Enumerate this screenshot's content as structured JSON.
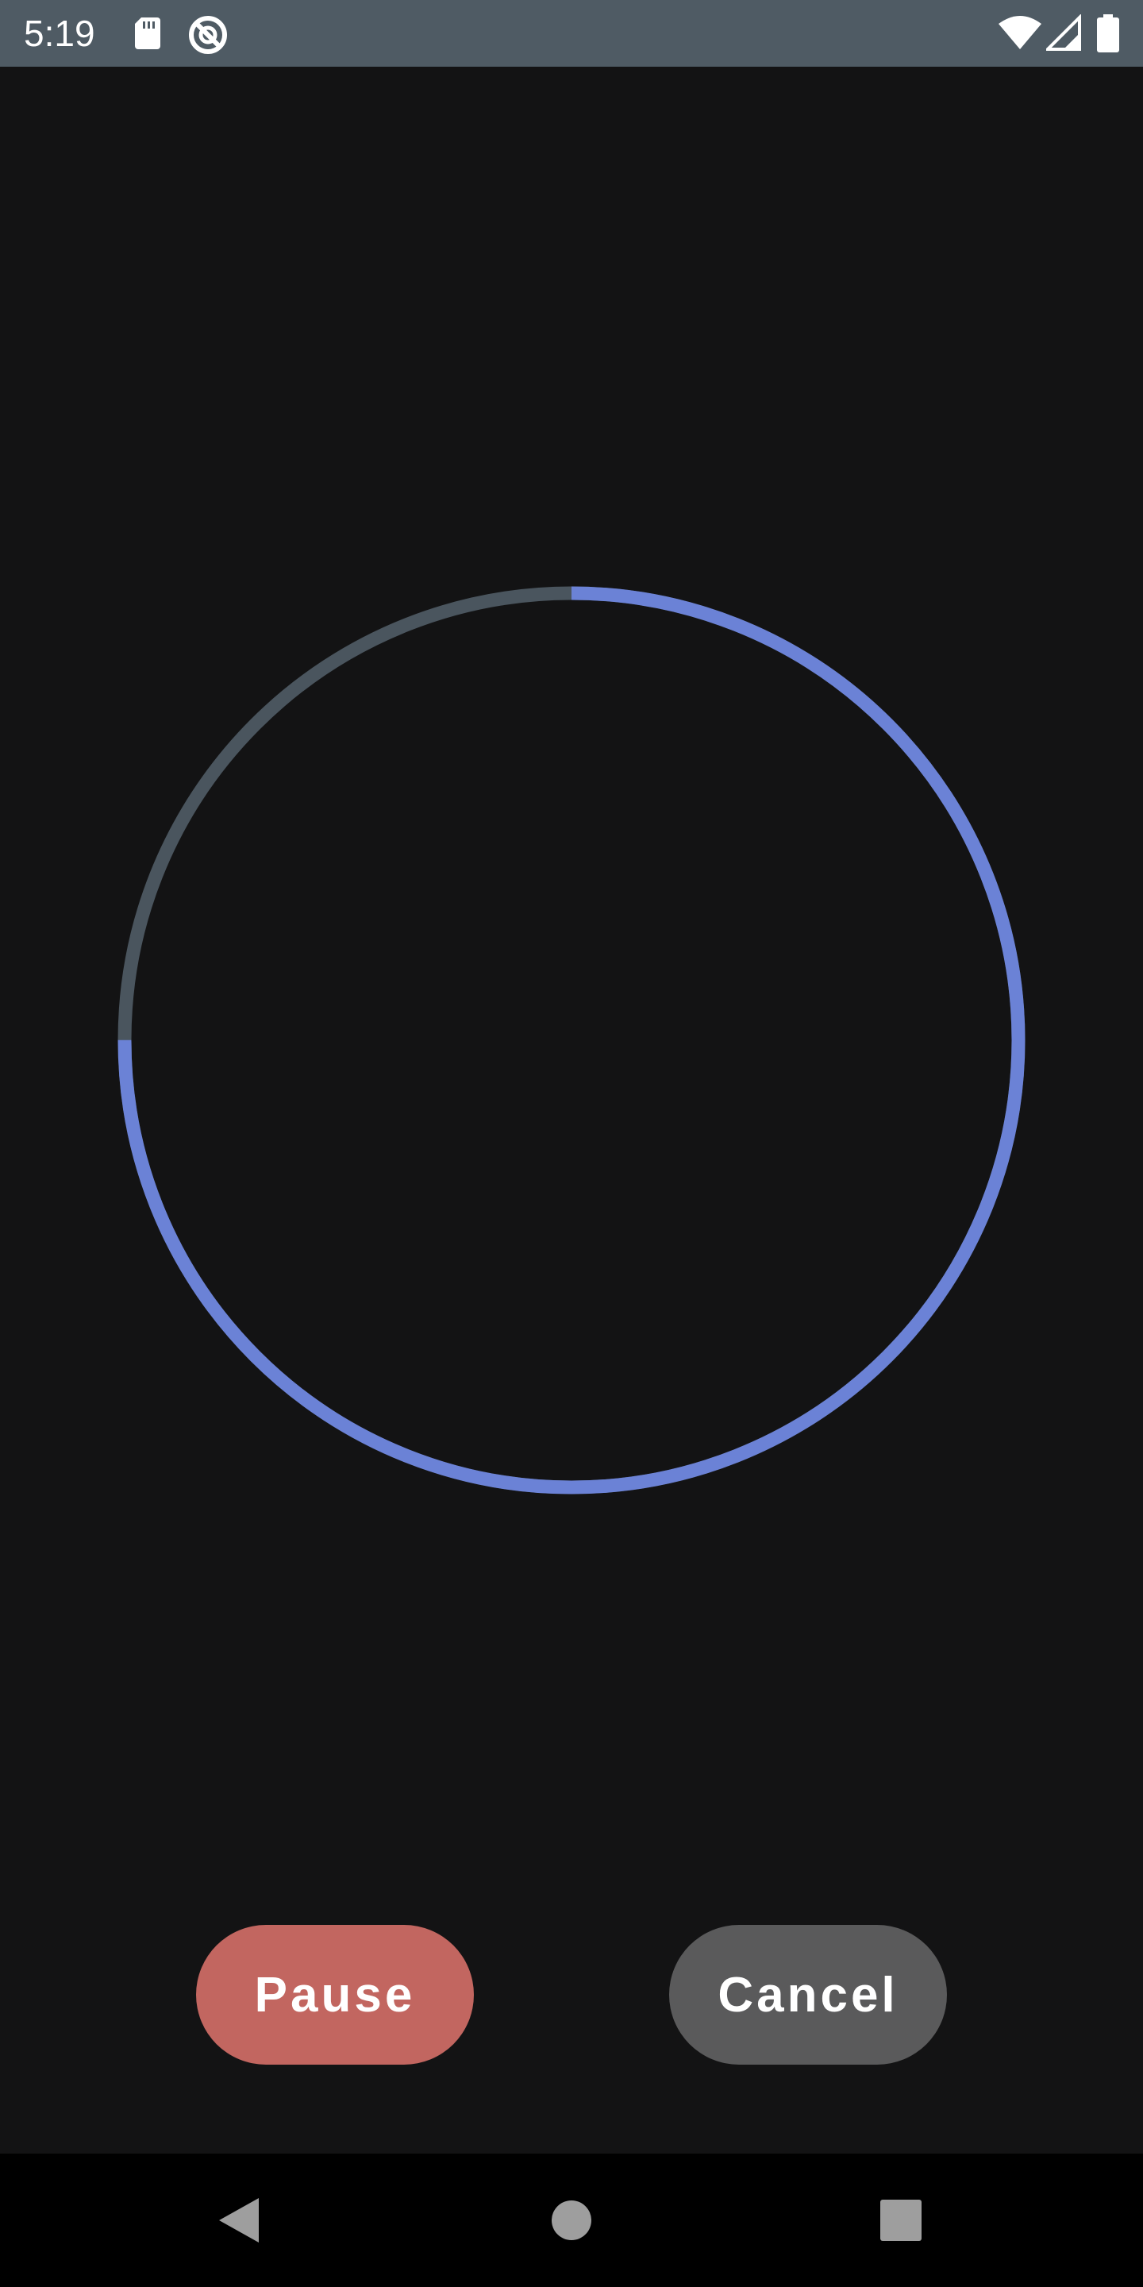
{
  "status_bar": {
    "time": "5:19",
    "background": "#4f5b64",
    "left_icons": [
      "sd-card-icon",
      "no-disturb-icon"
    ],
    "right_icons": [
      "wifi-icon",
      "cell-signal-icon",
      "battery-icon"
    ]
  },
  "timer": {
    "progress_fraction": 0.75,
    "progress_color": "#6b82d6",
    "track_color": "#4a555e"
  },
  "buttons": {
    "pause_label": "Pause",
    "pause_color": "#c26660",
    "cancel_label": "Cancel",
    "cancel_color": "#5a5a5b"
  },
  "nav_bar": {
    "items": [
      "back-icon",
      "home-icon",
      "recents-icon"
    ],
    "icon_color": "#9e9e9e"
  }
}
